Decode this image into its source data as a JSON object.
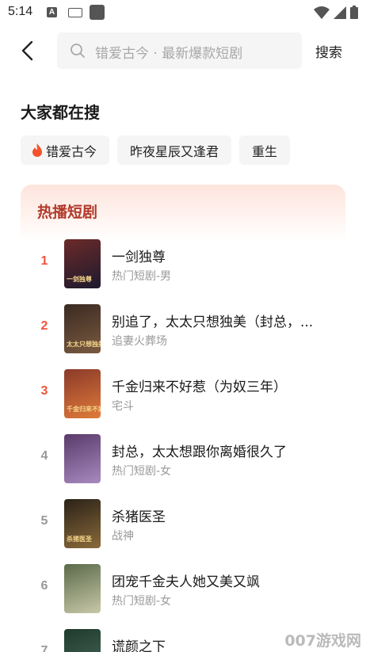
{
  "status_bar": {
    "time": "5:14"
  },
  "search": {
    "placeholder": "错爱古今 · 最新爆款短剧",
    "button_label": "搜索"
  },
  "trending": {
    "title": "大家都在搜",
    "chips": [
      "错爱古今",
      "昨夜星辰又逢君",
      "重生"
    ]
  },
  "hot": {
    "title": "热播短剧",
    "items": [
      {
        "rank": "1",
        "title": "一剑独尊",
        "tag": "热门短剧-男",
        "poster_text": "一剑独尊",
        "colors": [
          "#6b2a2a",
          "#1d1a2e"
        ]
      },
      {
        "rank": "2",
        "title": "别追了，太太只想独美（封总，...",
        "tag": "追妻火葬场",
        "poster_text": "太太只想独美",
        "colors": [
          "#3a2a22",
          "#7a5a40"
        ]
      },
      {
        "rank": "3",
        "title": "千金归来不好惹（为奴三年）",
        "tag": "宅斗",
        "poster_text": "千金归来不好惹",
        "colors": [
          "#8a3a2a",
          "#e07a3a"
        ]
      },
      {
        "rank": "4",
        "title": "封总，太太想跟你离婚很久了",
        "tag": "热门短剧-女",
        "poster_text": "",
        "colors": [
          "#5a3a6a",
          "#a88ac0"
        ]
      },
      {
        "rank": "5",
        "title": "杀猪医圣",
        "tag": "战神",
        "poster_text": "杀猪医圣",
        "colors": [
          "#2a2218",
          "#8a6a3a"
        ]
      },
      {
        "rank": "6",
        "title": "团宠千金夫人她又美又飒",
        "tag": "热门短剧-女",
        "poster_text": "",
        "colors": [
          "#5a6a4a",
          "#c8c8a8"
        ]
      },
      {
        "rank": "7",
        "title": "谎颜之下",
        "tag": "",
        "poster_text": "",
        "colors": [
          "#1e3a2e",
          "#4a6a5a"
        ]
      }
    ]
  },
  "watermark": "007游戏网"
}
